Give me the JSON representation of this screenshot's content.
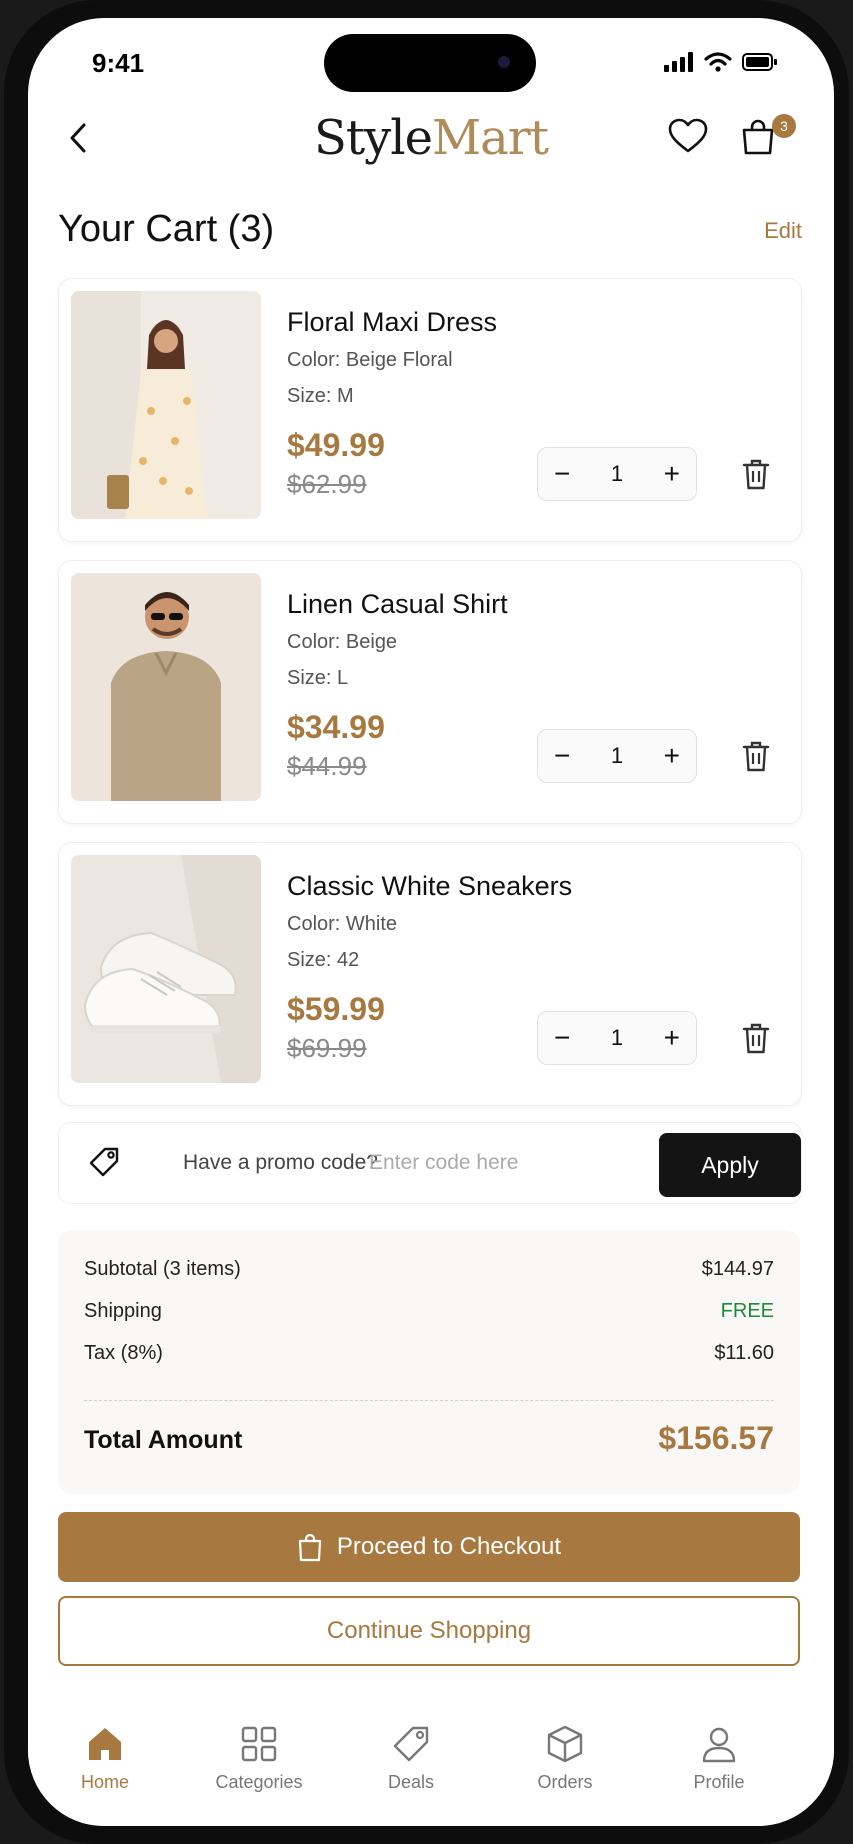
{
  "status_bar": {
    "time": "9:41"
  },
  "header": {
    "logo_part1": "Style",
    "logo_part2": "Mart",
    "cart_count": "3"
  },
  "cart": {
    "title": "Your Cart (3)",
    "edit_label": "Edit",
    "items": [
      {
        "name": "Floral Maxi Dress",
        "color": "Color: Beige Floral",
        "size": "Size: M",
        "price": "$49.99",
        "old_price": "$62.99",
        "qty": "1"
      },
      {
        "name": "Linen Casual Shirt",
        "color": "Color: Beige",
        "size": "Size: L",
        "price": "$34.99",
        "old_price": "$44.99",
        "qty": "1"
      },
      {
        "name": "Classic White Sneakers",
        "color": "Color: White",
        "size": "Size: 42",
        "price": "$59.99",
        "old_price": "$69.99",
        "qty": "1"
      }
    ]
  },
  "promo": {
    "question": "Have a promo code?",
    "placeholder": "Enter code here",
    "apply_label": "Apply"
  },
  "summary": {
    "subtotal_label": "Subtotal (3 items)",
    "subtotal_value": "$144.97",
    "shipping_label": "Shipping",
    "shipping_value": "FREE",
    "tax_label": "Tax (8%)",
    "tax_value": "$11.60",
    "total_label": "Total Amount",
    "total_value": "$156.57"
  },
  "actions": {
    "checkout_label": "Proceed to Checkout",
    "continue_label": "Continue Shopping"
  },
  "nav": {
    "items": [
      {
        "label": "Home",
        "icon": "home-icon"
      },
      {
        "label": "Categories",
        "icon": "grid-icon"
      },
      {
        "label": "Deals",
        "icon": "tag-icon"
      },
      {
        "label": "Orders",
        "icon": "box-icon"
      },
      {
        "label": "Profile",
        "icon": "user-icon"
      }
    ]
  },
  "colors": {
    "accent": "#a77940",
    "free": "#1d8a3a",
    "dark": "#141414"
  }
}
